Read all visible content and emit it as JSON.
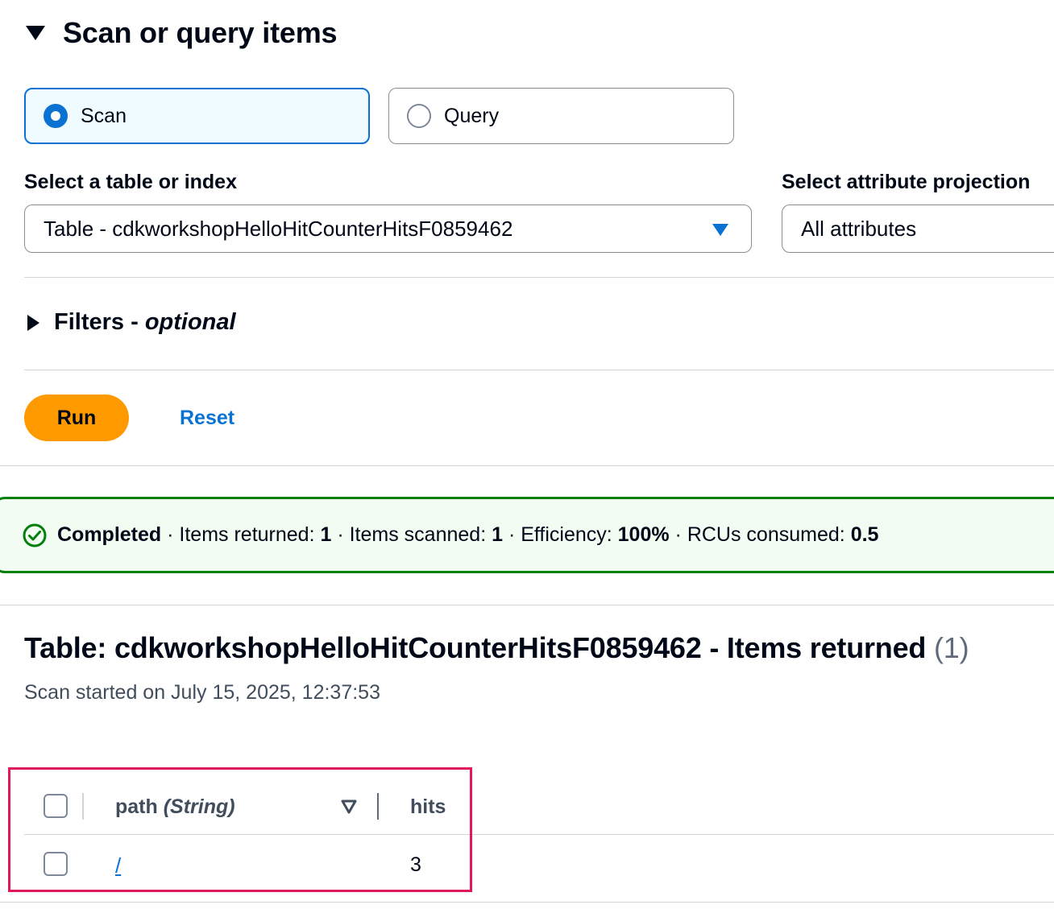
{
  "section": {
    "title": "Scan or query items"
  },
  "mode_tiles": [
    {
      "label": "Scan",
      "selected": true
    },
    {
      "label": "Query",
      "selected": false
    }
  ],
  "table_select": {
    "label": "Select a table or index",
    "value": "Table - cdkworkshopHelloHitCounterHitsF0859462"
  },
  "projection_select": {
    "label": "Select attribute projection",
    "value": "All attributes"
  },
  "filters": {
    "label": "Filters - ",
    "optional": "optional"
  },
  "actions": {
    "run": "Run",
    "reset": "Reset"
  },
  "status": {
    "state": "Completed",
    "items_returned_label": "Items returned: ",
    "items_returned": "1",
    "items_scanned_label": "Items scanned: ",
    "items_scanned": "1",
    "efficiency_label": "Efficiency: ",
    "efficiency": "100%",
    "rcus_label": "RCUs consumed: ",
    "rcus": "0.5",
    "sep": " · ",
    "success_color": "#037f0c"
  },
  "results": {
    "title": "Table: cdkworkshopHelloHitCounterHitsF0859462 - Items returned",
    "count": "(1)",
    "scan_started": "Scan started on July 15, 2025, 12:37:53"
  },
  "items_table": {
    "columns": [
      {
        "name": "path",
        "type": "(String)"
      },
      {
        "name": "hits",
        "type": ""
      }
    ],
    "rows": [
      {
        "path": "/",
        "hits": "3"
      }
    ]
  },
  "colors": {
    "accent": "#0972d3",
    "run_button": "#ff9900",
    "highlight_box": "#e0195c"
  }
}
